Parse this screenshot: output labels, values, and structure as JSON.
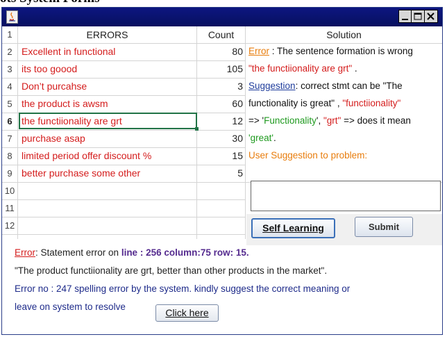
{
  "page": {
    "heading": "ots System Forms"
  },
  "window": {
    "icon": "java-cup-icon",
    "controls": [
      "minimize-icon",
      "maximize-icon",
      "close-icon"
    ]
  },
  "table": {
    "headers": {
      "errors": "ERRORS",
      "count": "Count",
      "solution": "Solution"
    },
    "row_numbers": [
      "1",
      "2",
      "3",
      "4",
      "5",
      "6",
      "7",
      "8",
      "9",
      "10",
      "11",
      "12"
    ],
    "active_row": "6",
    "rows": [
      {
        "error": "Excellent in functional",
        "count": "80"
      },
      {
        "error": "its too goood",
        "count": "105"
      },
      {
        "error": "Don’t purcahse",
        "count": "3"
      },
      {
        "error": "the product is awsm",
        "count": "60"
      },
      {
        "error": "the functiionality are grt",
        "count": "12"
      },
      {
        "error": "purchase asap",
        "count": "30"
      },
      {
        "error": "limited period offer discount %",
        "count": "15"
      },
      {
        "error": "better purchase some other",
        "count": "5"
      }
    ]
  },
  "solution": {
    "line1": {
      "label": "Error",
      "text": " : The sentence formation is wrong"
    },
    "line2": {
      "quote": "\"the functiionality are grt\"",
      "text": " ."
    },
    "line3": {
      "label": "Suggestion",
      "text": ": correct stmt can be \"The"
    },
    "line4": {
      "text": "functionality is great\" , ",
      "quote": "\"functiionality\""
    },
    "line5": {
      "arrow1": "=> '",
      "word1": "Functionality",
      "sep": "', ",
      "word2": "\"grt\"",
      "arrow2": " => does it mean"
    },
    "line6": {
      "word": "'great'",
      "end": "."
    },
    "user_suggestion_label": "User Suggestion to problem:",
    "input_value": ""
  },
  "buttons": {
    "self_learning": "Self Learning",
    "submit": "Submit",
    "click_here": "Click here"
  },
  "bottom": {
    "line1": {
      "label": "Error",
      "text": ": Statement error on ",
      "location": "line : 256 column:75 row: 15."
    },
    "line2": "\"The product functiionality are grt, better than other products in the market\".",
    "line3": "Error no : 247 spelling error by the system. kindly suggest the correct meaning or",
    "line4": "leave on system to resolve"
  },
  "colors": {
    "title_bar": "#0d1680",
    "error_text": "#d41c1c",
    "label_orange": "#e87d0d",
    "label_blue": "#1f3d9c",
    "green": "#1f9a1f",
    "selection": "#217346"
  }
}
